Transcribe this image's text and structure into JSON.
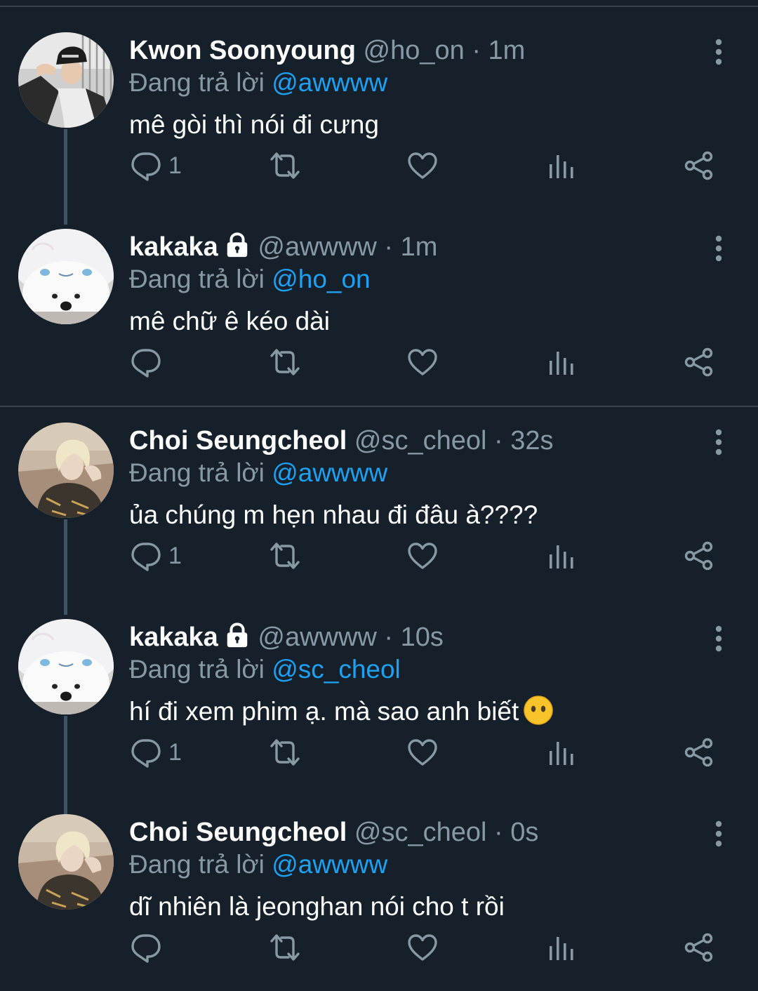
{
  "colors": {
    "background": "#15202b",
    "divider": "#38444d",
    "thread_line": "#3d5466",
    "text_primary": "#ffffff",
    "text_secondary": "#8899a6",
    "accent": "#1da1f2"
  },
  "reply_prefix": "Đang trả lời",
  "tweets": [
    {
      "name": "Kwon Soonyoung",
      "handle": "@ho_on",
      "separator": "·",
      "time": "1m",
      "reply_to": "@awwww",
      "text": "mê gòi thì nói đi cưng",
      "reply_count": "1",
      "locked": false,
      "avatar": "person-photo"
    },
    {
      "name": "kakaka",
      "handle": "@awwww",
      "separator": "·",
      "time": "1m",
      "reply_to": "@ho_on",
      "text": "mê chữ ê kéo dài",
      "reply_count": "",
      "locked": true,
      "avatar": "samoyed-dog-photo"
    },
    {
      "name": "Choi Seungcheol",
      "handle": "@sc_cheol",
      "separator": "·",
      "time": "32s",
      "reply_to": "@awwww",
      "text": "ủa chúng m hẹn nhau đi đâu à????",
      "reply_count": "1",
      "locked": false,
      "avatar": "blond-person-photo"
    },
    {
      "name": "kakaka",
      "handle": "@awwww",
      "separator": "·",
      "time": "10s",
      "reply_to": "@sc_cheol",
      "text": "hí đi xem phim ạ. mà sao anh biết",
      "emoji": "face-without-mouth",
      "reply_count": "1",
      "locked": true,
      "avatar": "samoyed-dog-photo"
    },
    {
      "name": "Choi Seungcheol",
      "handle": "@sc_cheol",
      "separator": "·",
      "time": "0s",
      "reply_to": "@awwww",
      "text": "dĩ nhiên là jeonghan nói cho t rồi",
      "reply_count": "",
      "locked": false,
      "avatar": "blond-person-photo"
    }
  ],
  "icons": {
    "reply": "reply-icon",
    "retweet": "retweet-icon",
    "like": "heart-icon",
    "stats": "analytics-icon",
    "share": "share-icon",
    "more": "more-vertical-icon",
    "protected": "lock-icon"
  }
}
